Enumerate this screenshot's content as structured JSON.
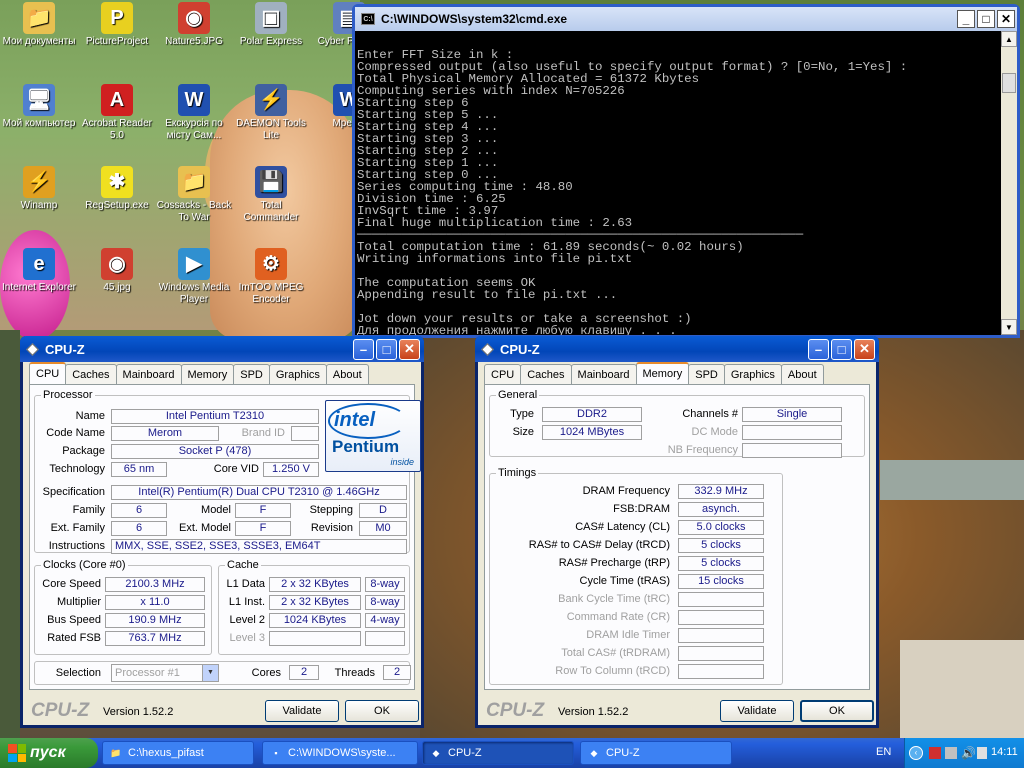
{
  "desktop_icons": [
    {
      "label": "Мои документы",
      "glyph": "📁",
      "color": "#e8c050"
    },
    {
      "label": "PictureProject",
      "glyph": "P",
      "color": "#e8d020"
    },
    {
      "label": "Nature5.JPG",
      "glyph": "◉",
      "color": "#d04030"
    },
    {
      "label": "Polar Express",
      "glyph": "▣",
      "color": "#a0b0c0"
    },
    {
      "label": "Cyber Powe...",
      "glyph": "▤",
      "color": "#6080c0"
    },
    {
      "label": "Мой компьютер",
      "glyph": "🖥",
      "color": "#5080d0"
    },
    {
      "label": "Acrobat Reader 5.0",
      "glyph": "A",
      "color": "#d02020"
    },
    {
      "label": "Екскурсія по місту Сам...",
      "glyph": "W",
      "color": "#2050b0"
    },
    {
      "label": "DAEMON Tools Lite",
      "glyph": "⚡",
      "color": "#4060a0"
    },
    {
      "label": "Мрев...",
      "glyph": "W",
      "color": "#2050b0"
    },
    {
      "label": "Winamp",
      "glyph": "⚡",
      "color": "#e0a020"
    },
    {
      "label": "RegSetup.exe",
      "glyph": "✱",
      "color": "#f0e020"
    },
    {
      "label": "Cossacks - Back To War",
      "glyph": "📁",
      "color": "#e8c050"
    },
    {
      "label": "Total Commander",
      "glyph": "💾",
      "color": "#3050a0"
    },
    {
      "label": "Internet Explorer",
      "glyph": "e",
      "color": "#2070d0"
    },
    {
      "label": "45.jpg",
      "glyph": "◉",
      "color": "#d04030"
    },
    {
      "label": "Windows Media Player",
      "glyph": "▶",
      "color": "#3090d0"
    },
    {
      "label": "ImTOO MPEG Encoder",
      "glyph": "⚙",
      "color": "#e06020"
    }
  ],
  "cmd": {
    "title": "C:\\WINDOWS\\system32\\cmd.exe",
    "lines": [
      "Enter FFT Size in k :",
      "Compressed output (also useful to specify output format) ? [0=No, 1=Yes] :",
      "Total Physical Memory Allocated = 61372 Kbytes",
      "Computing series with index N=705226",
      "Starting step 6",
      "Starting step 5 ...",
      "Starting step 4 ...",
      "Starting step 3 ...",
      "Starting step 2 ...",
      "Starting step 1 ...",
      "Starting step 0 ...",
      "Series computing time : 48.80",
      "Division time : 6.25",
      "InvSqrt time : 3.97",
      "Final huge multiplication time : 2.63",
      "────────────────────────────────────────────────────────────",
      "Total computation time : 61.89 seconds(~ 0.02 hours)",
      "Writing informations into file pi.txt",
      "",
      "The computation seems OK",
      "Appending result to file pi.txt ...",
      "",
      "Jot down your results or take a screenshot :)",
      "Для продолжения нажмите любую клавишу . . ."
    ]
  },
  "cpuz_left": {
    "title": "CPU-Z",
    "tabs": [
      "CPU",
      "Caches",
      "Mainboard",
      "Memory",
      "SPD",
      "Graphics",
      "About"
    ],
    "active_tab": "CPU",
    "processor_label": "Processor",
    "name_label": "Name",
    "name": "Intel Pentium T2310",
    "codename_label": "Code Name",
    "codename": "Merom",
    "brandid_label": "Brand ID",
    "package_label": "Package",
    "package": "Socket P (478)",
    "technology_label": "Technology",
    "technology": "65 nm",
    "corevid_label": "Core VID",
    "corevid": "1.250 V",
    "spec_label": "Specification",
    "spec": "Intel(R) Pentium(R) Dual  CPU  T2310  @ 1.46GHz",
    "family_label": "Family",
    "family": "6",
    "model_label": "Model",
    "model": "F",
    "stepping_label": "Stepping",
    "stepping": "D",
    "extfamily_label": "Ext. Family",
    "extfamily": "6",
    "extmodel_label": "Ext. Model",
    "extmodel": "F",
    "revision_label": "Revision",
    "revision": "M0",
    "instructions_label": "Instructions",
    "instructions": "MMX, SSE, SSE2, SSE3, SSSE3, EM64T",
    "logo": {
      "brand": "intel",
      "product": "Pentium",
      "tag": "inside"
    },
    "clocks_label": "Clocks (Core #0)",
    "corespeed_label": "Core Speed",
    "corespeed": "2100.3 MHz",
    "multiplier_label": "Multiplier",
    "multiplier": "x 11.0",
    "busspeed_label": "Bus Speed",
    "busspeed": "190.9 MHz",
    "ratedfsb_label": "Rated FSB",
    "ratedfsb": "763.7 MHz",
    "cache_label": "Cache",
    "l1data_label": "L1 Data",
    "l1data": "2 x 32 KBytes",
    "l1data_way": "8-way",
    "l1inst_label": "L1 Inst.",
    "l1inst": "2 x 32 KBytes",
    "l1inst_way": "8-way",
    "level2_label": "Level 2",
    "level2": "1024 KBytes",
    "level2_way": "4-way",
    "level3_label": "Level 3",
    "selection_label": "Selection",
    "selection": "Processor #1",
    "cores_label": "Cores",
    "cores": "2",
    "threads_label": "Threads",
    "threads": "2",
    "footer_logo": "CPU-Z",
    "version": "Version 1.52.2",
    "validate": "Validate",
    "ok": "OK"
  },
  "cpuz_right": {
    "title": "CPU-Z",
    "tabs": [
      "CPU",
      "Caches",
      "Mainboard",
      "Memory",
      "SPD",
      "Graphics",
      "About"
    ],
    "active_tab": "Memory",
    "general_label": "General",
    "type_label": "Type",
    "type": "DDR2",
    "size_label": "Size",
    "size": "1024 MBytes",
    "channels_label": "Channels #",
    "channels": "Single",
    "dcmode_label": "DC Mode",
    "nbfreq_label": "NB Frequency",
    "timings_label": "Timings",
    "timings": [
      {
        "label": "DRAM Frequency",
        "value": "332.9 MHz",
        "dim": false
      },
      {
        "label": "FSB:DRAM",
        "value": "asynch.",
        "dim": false
      },
      {
        "label": "CAS# Latency (CL)",
        "value": "5.0 clocks",
        "dim": false
      },
      {
        "label": "RAS# to CAS# Delay (tRCD)",
        "value": "5 clocks",
        "dim": false
      },
      {
        "label": "RAS# Precharge (tRP)",
        "value": "5 clocks",
        "dim": false
      },
      {
        "label": "Cycle Time (tRAS)",
        "value": "15 clocks",
        "dim": false
      },
      {
        "label": "Bank Cycle Time (tRC)",
        "value": "",
        "dim": true
      },
      {
        "label": "Command Rate (CR)",
        "value": "",
        "dim": true
      },
      {
        "label": "DRAM Idle Timer",
        "value": "",
        "dim": true
      },
      {
        "label": "Total CAS# (tRDRAM)",
        "value": "",
        "dim": true
      },
      {
        "label": "Row To Column (tRCD)",
        "value": "",
        "dim": true
      }
    ],
    "footer_logo": "CPU-Z",
    "version": "Version 1.52.2",
    "validate": "Validate",
    "ok": "OK"
  },
  "taskbar": {
    "start": "пуск",
    "tasks": [
      {
        "label": "C:\\hexus_pifast",
        "icon": "📁",
        "active": false
      },
      {
        "label": "C:\\WINDOWS\\syste...",
        "icon": "▪",
        "active": false
      },
      {
        "label": "CPU-Z",
        "icon": "◆",
        "active": true
      },
      {
        "label": "CPU-Z",
        "icon": "◆",
        "active": false
      }
    ],
    "lang": "EN",
    "clock": "14:11"
  }
}
